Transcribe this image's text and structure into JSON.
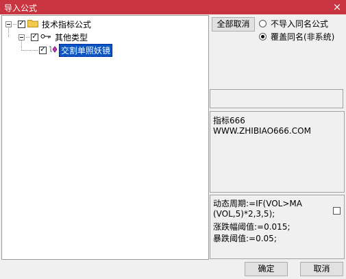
{
  "window": {
    "title": "导入公式",
    "close_glyph": "×"
  },
  "tree": {
    "root": {
      "label": "技术指标公式",
      "check": "✓",
      "icon": "folder-icon"
    },
    "group": {
      "label": "其他类型",
      "check": "✓",
      "icon": "key-icon"
    },
    "item": {
      "label": "交割单照妖镜",
      "check": "✓",
      "icon": "formula-diamond-icon"
    }
  },
  "toolbar": {
    "cancel_all_label": "全部取消"
  },
  "options": {
    "skip_same_name_label": "不导入同名公式",
    "overwrite_same_name_label": "覆盖同名(非系统)",
    "selected": "overwrite"
  },
  "info": {
    "line1": "指标666",
    "line2": "WWW.ZHIBIAO666.COM"
  },
  "formula": {
    "line1": "动态周期:=IF(VOL>MA",
    "line2": "(VOL,5)*2,3,5);",
    "line3": "涨跌幅阈值:=0.015;",
    "line4": "暴跌阈值:=0.05;"
  },
  "footer": {
    "ok_label": "确定",
    "cancel_label": "取消"
  },
  "colors": {
    "titlebar": "#c8343f",
    "selection": "#0a55c4",
    "folder": "#f2c94c"
  }
}
